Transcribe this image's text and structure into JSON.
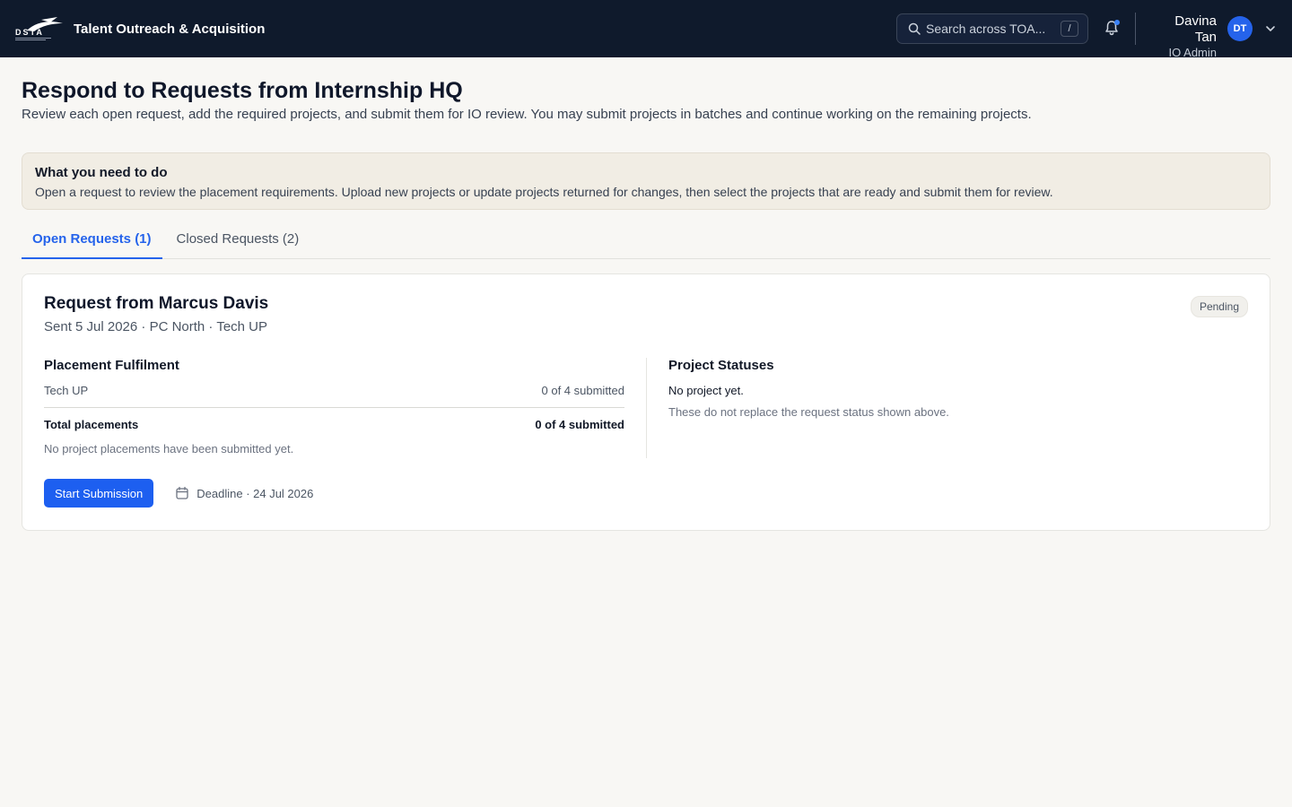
{
  "header": {
    "app_title": "Talent Outreach & Acquisition",
    "logo_text": "DSTA",
    "search_placeholder": "Search across TOA...",
    "search_shortcut": "/",
    "user": {
      "name": "Davina Tan",
      "role": "IO Admin",
      "initials": "DT"
    }
  },
  "page": {
    "title": "Respond to Requests from Internship HQ",
    "subtitle": "Review each open request, add the required projects, and submit them for IO review. You may submit projects in batches and continue working on the remaining projects."
  },
  "notice": {
    "title": "What you need to do",
    "text": "Open a request to review the placement requirements. Upload new projects or update projects returned for changes, then select the projects that are ready and submit them for review."
  },
  "tabs": [
    {
      "label": "Open Requests (1)",
      "active": true
    },
    {
      "label": "Closed Requests (2)",
      "active": false
    }
  ],
  "request": {
    "title": "Request from Marcus Davis",
    "meta": "Sent 5 Jul 2026 · PC North · Tech UP",
    "status": "Pending",
    "fulfilment": {
      "title": "Placement Fulfilment",
      "rows": [
        {
          "label": "Tech UP",
          "value": "0 of 4 submitted"
        }
      ],
      "total": {
        "label": "Total placements",
        "value": "0 of 4 submitted"
      },
      "note": "No project placements have been submitted yet."
    },
    "project_statuses": {
      "title": "Project Statuses",
      "status": "No project yet.",
      "note": "These do not replace the request status shown above."
    },
    "action_label": "Start Submission",
    "deadline": "Deadline · 24 Jul 2026"
  },
  "colors": {
    "header_bg": "#0f1a2c",
    "accent": "#2563eb",
    "page_bg": "#f8f7f4"
  }
}
